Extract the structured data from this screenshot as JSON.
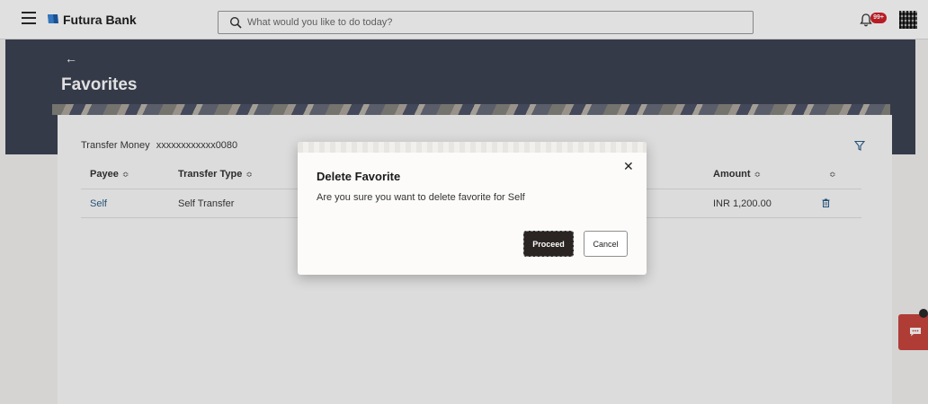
{
  "header": {
    "brand": "Futura Bank",
    "search_placeholder": "What would you like to do today?",
    "notification_count": "99+"
  },
  "hero": {
    "back_label": "←",
    "title": "Favorites"
  },
  "favorites": {
    "account_label": "Transfer Money",
    "account_number": "xxxxxxxxxxxx0080",
    "columns": [
      "Payee",
      "Transfer Type",
      "Amount"
    ],
    "sort_glyph": "≎",
    "rows": [
      {
        "payee": "Self",
        "transfer_type": "Self Transfer",
        "amount": "INR 1,200.00"
      }
    ]
  },
  "modal": {
    "title": "Delete Favorite",
    "message": "Are you sure you want to delete favorite for Self",
    "close_glyph": "✕",
    "proceed_label": "Proceed",
    "cancel_label": "Cancel"
  },
  "colors": {
    "hero_bg": "#3d4254",
    "primary_button": "#2a2522",
    "link": "#2b5f8a",
    "chat_widget": "#c8463e",
    "badge": "#d3202a"
  }
}
